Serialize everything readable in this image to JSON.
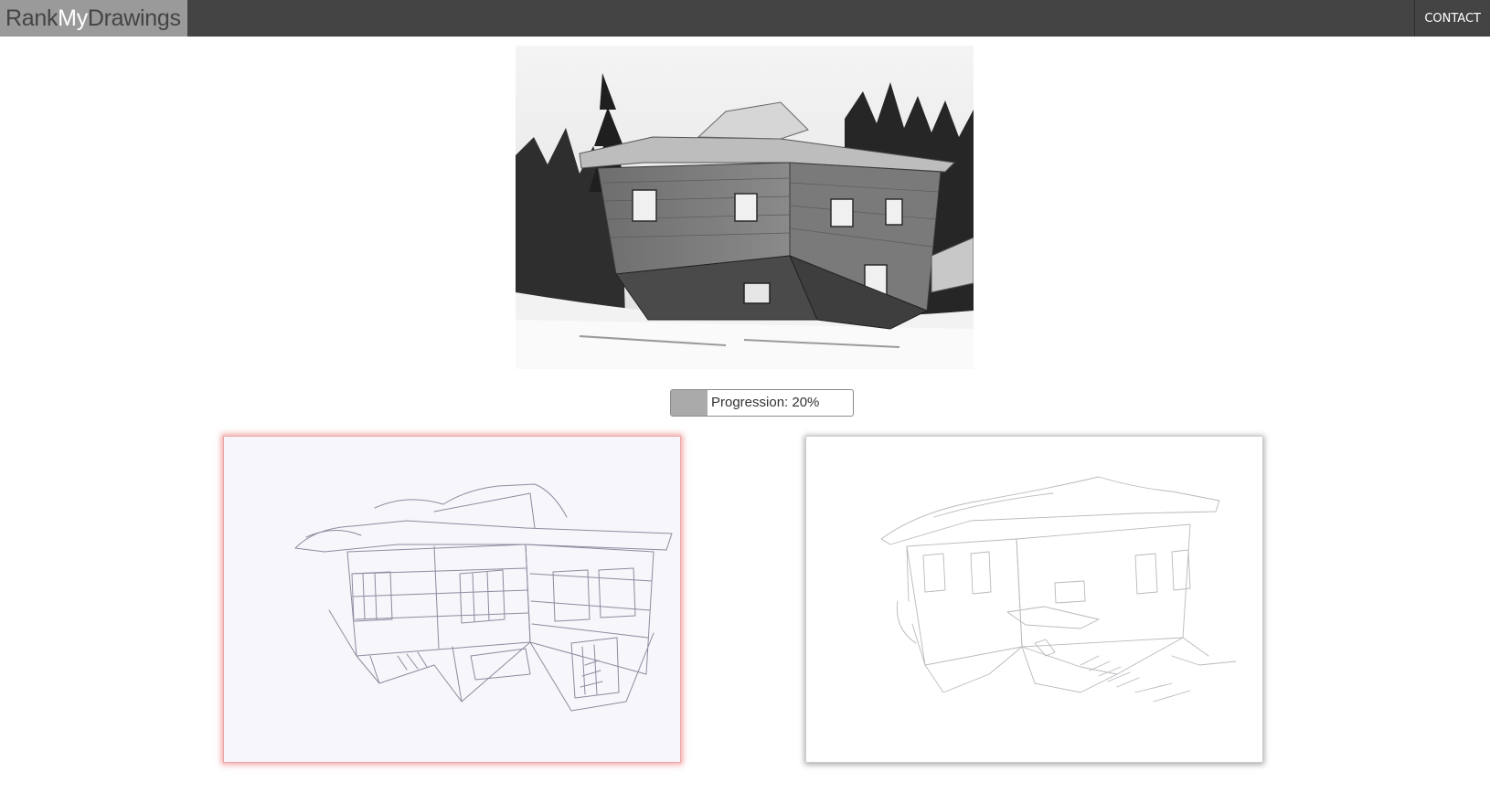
{
  "header": {
    "brand": {
      "part1": "Rank",
      "part2": "My",
      "part3": "Drawings"
    },
    "contact_label": "CONTACT"
  },
  "reference_photo": {
    "subject": "upside-down wooden house in snowy forest (grayscale photo)"
  },
  "progress": {
    "label": "Progression: 20%",
    "value_fraction": 0.2
  },
  "drawings": [
    {
      "id": "left",
      "subject": "pencil sketch of upside-down house",
      "highlighted": true
    },
    {
      "id": "right",
      "subject": "light pencil sketch of upside-down house",
      "highlighted": false
    }
  ],
  "colors": {
    "topbar": "#444444",
    "brand_bg": "#9a9a9a",
    "brand_accent": "#ffffff",
    "highlight_glow": "#e65a5a",
    "progress_fill": "#aaaaaa"
  }
}
